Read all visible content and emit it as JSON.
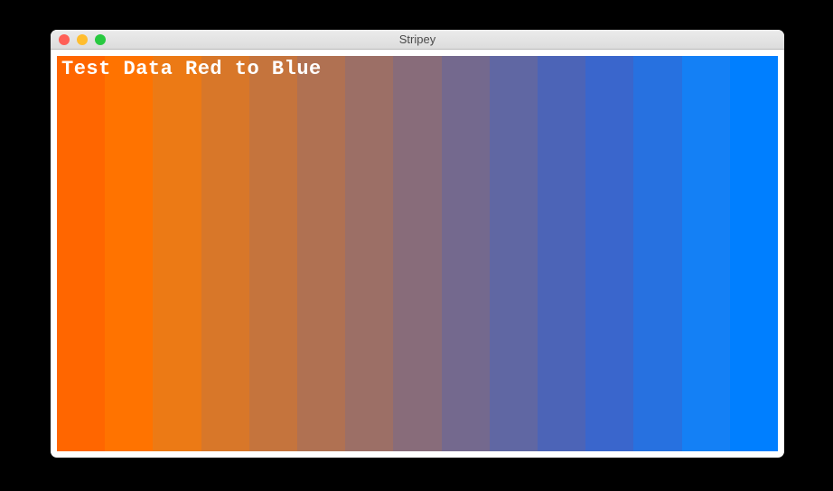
{
  "window": {
    "title": "Stripey",
    "traffic_lights": {
      "close_color": "#ff5f57",
      "minimize_color": "#ffbd2e",
      "zoom_color": "#28c940"
    }
  },
  "content": {
    "overlay_text": "Test Data Red to Blue",
    "stripes": [
      "#ff6600",
      "#ff7300",
      "#ec7a15",
      "#d87729",
      "#c5743d",
      "#b07152",
      "#9c6f66",
      "#886c7a",
      "#74698e",
      "#6067a3",
      "#4c64b7",
      "#3a66cc",
      "#2771e0",
      "#1480f5",
      "#007fff"
    ]
  }
}
